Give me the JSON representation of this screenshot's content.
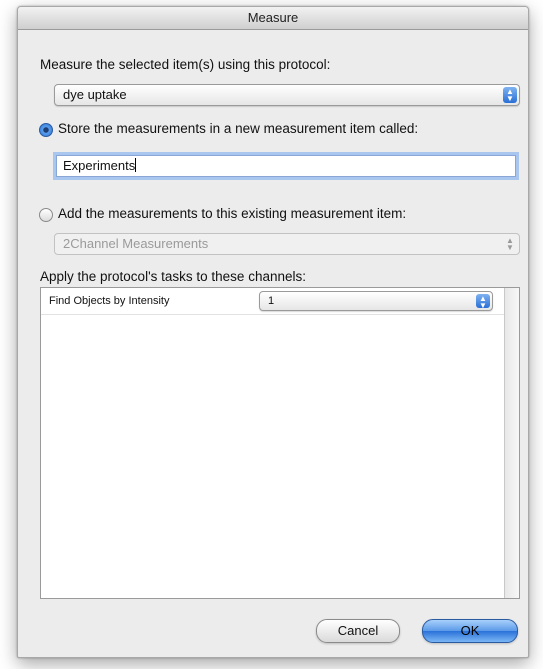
{
  "window": {
    "title": "Measure"
  },
  "protocol_section": {
    "label": "Measure the selected item(s) using this protocol:",
    "selected": "dye uptake"
  },
  "store_new": {
    "label": "Store the measurements in a new measurement item called:",
    "selected": true,
    "value": "Experiments"
  },
  "add_existing": {
    "label": "Add the measurements to this existing measurement item:",
    "selected": false,
    "value": "2Channel Measurements"
  },
  "channels": {
    "label": "Apply the protocol's tasks to these channels:",
    "rows": [
      {
        "task": "Find Objects by Intensity",
        "channel": "1"
      }
    ]
  },
  "buttons": {
    "cancel": "Cancel",
    "ok": "OK"
  },
  "colors": {
    "accent": "#2b72d9",
    "window_bg": "#ececec"
  }
}
